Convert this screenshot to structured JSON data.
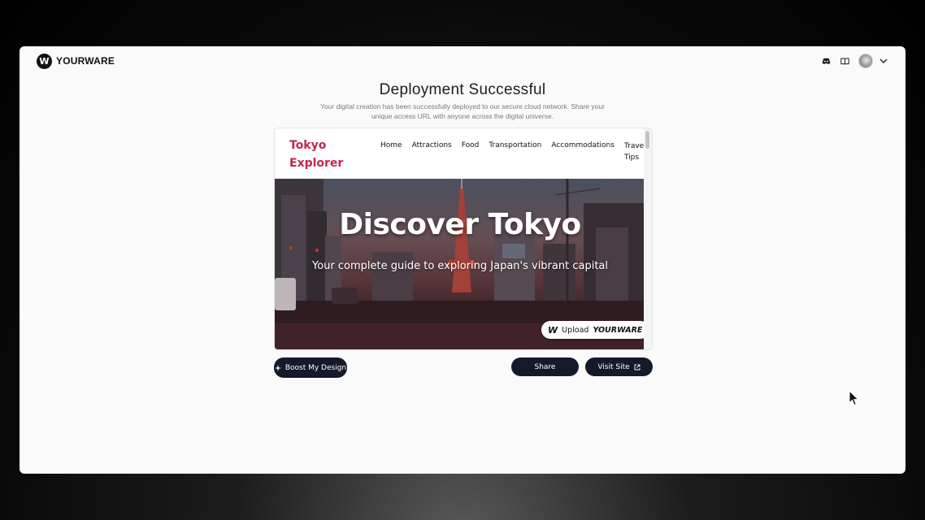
{
  "app": {
    "brand_letter": "W",
    "brand_name": "YOURWARE"
  },
  "header": {
    "icons": [
      "discord-icon",
      "book-icon",
      "avatar",
      "chevron-down-icon"
    ]
  },
  "main": {
    "title": "Deployment Successful",
    "subtitle": "Your digital creation has been successfully deployed to our secure cloud network. Share your unique access URL with anyone across the digital universe."
  },
  "preview": {
    "site_logo": "Tokyo Explorer",
    "nav": [
      "Home",
      "Attractions",
      "Food",
      "Transportation",
      "Accommodations",
      "Travel Tips"
    ],
    "hero_title": "Discover Tokyo",
    "hero_subtitle": "Your complete guide to exploring Japan's vibrant capital",
    "badge_prefix": "Upload",
    "badge_brand": "YOURWARE",
    "logo_color": "#c2264b"
  },
  "actions": {
    "boost_label": "Boost My Design",
    "share_label": "Share",
    "visit_label": "Visit Site",
    "button_color": "#151a2b"
  }
}
